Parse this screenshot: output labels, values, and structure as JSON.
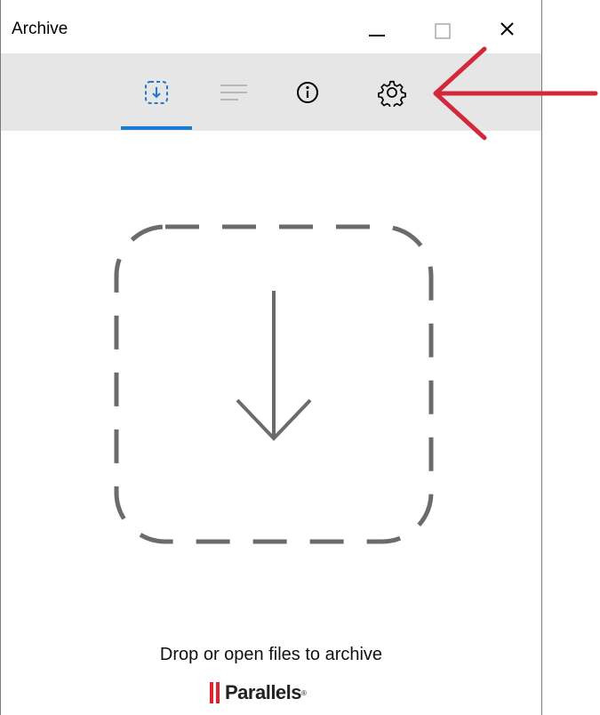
{
  "window": {
    "title": "Archive"
  },
  "toolbar": {
    "tabs": [
      {
        "name": "archive",
        "icon": "archive-drop-icon",
        "active": true
      },
      {
        "name": "list",
        "icon": "list-icon",
        "active": false
      },
      {
        "name": "info",
        "icon": "info-icon",
        "active": false
      },
      {
        "name": "settings",
        "icon": "gear-icon",
        "active": false
      }
    ]
  },
  "main": {
    "drop_hint": "Drop or open files to archive"
  },
  "branding": {
    "logo_text": "Parallels",
    "logo_mark": "®"
  },
  "colors": {
    "accent": "#1e78d7",
    "toolbar_bg": "#e6e6e6",
    "annotation_arrow": "#d3283b",
    "logo_red": "#e1232c"
  }
}
